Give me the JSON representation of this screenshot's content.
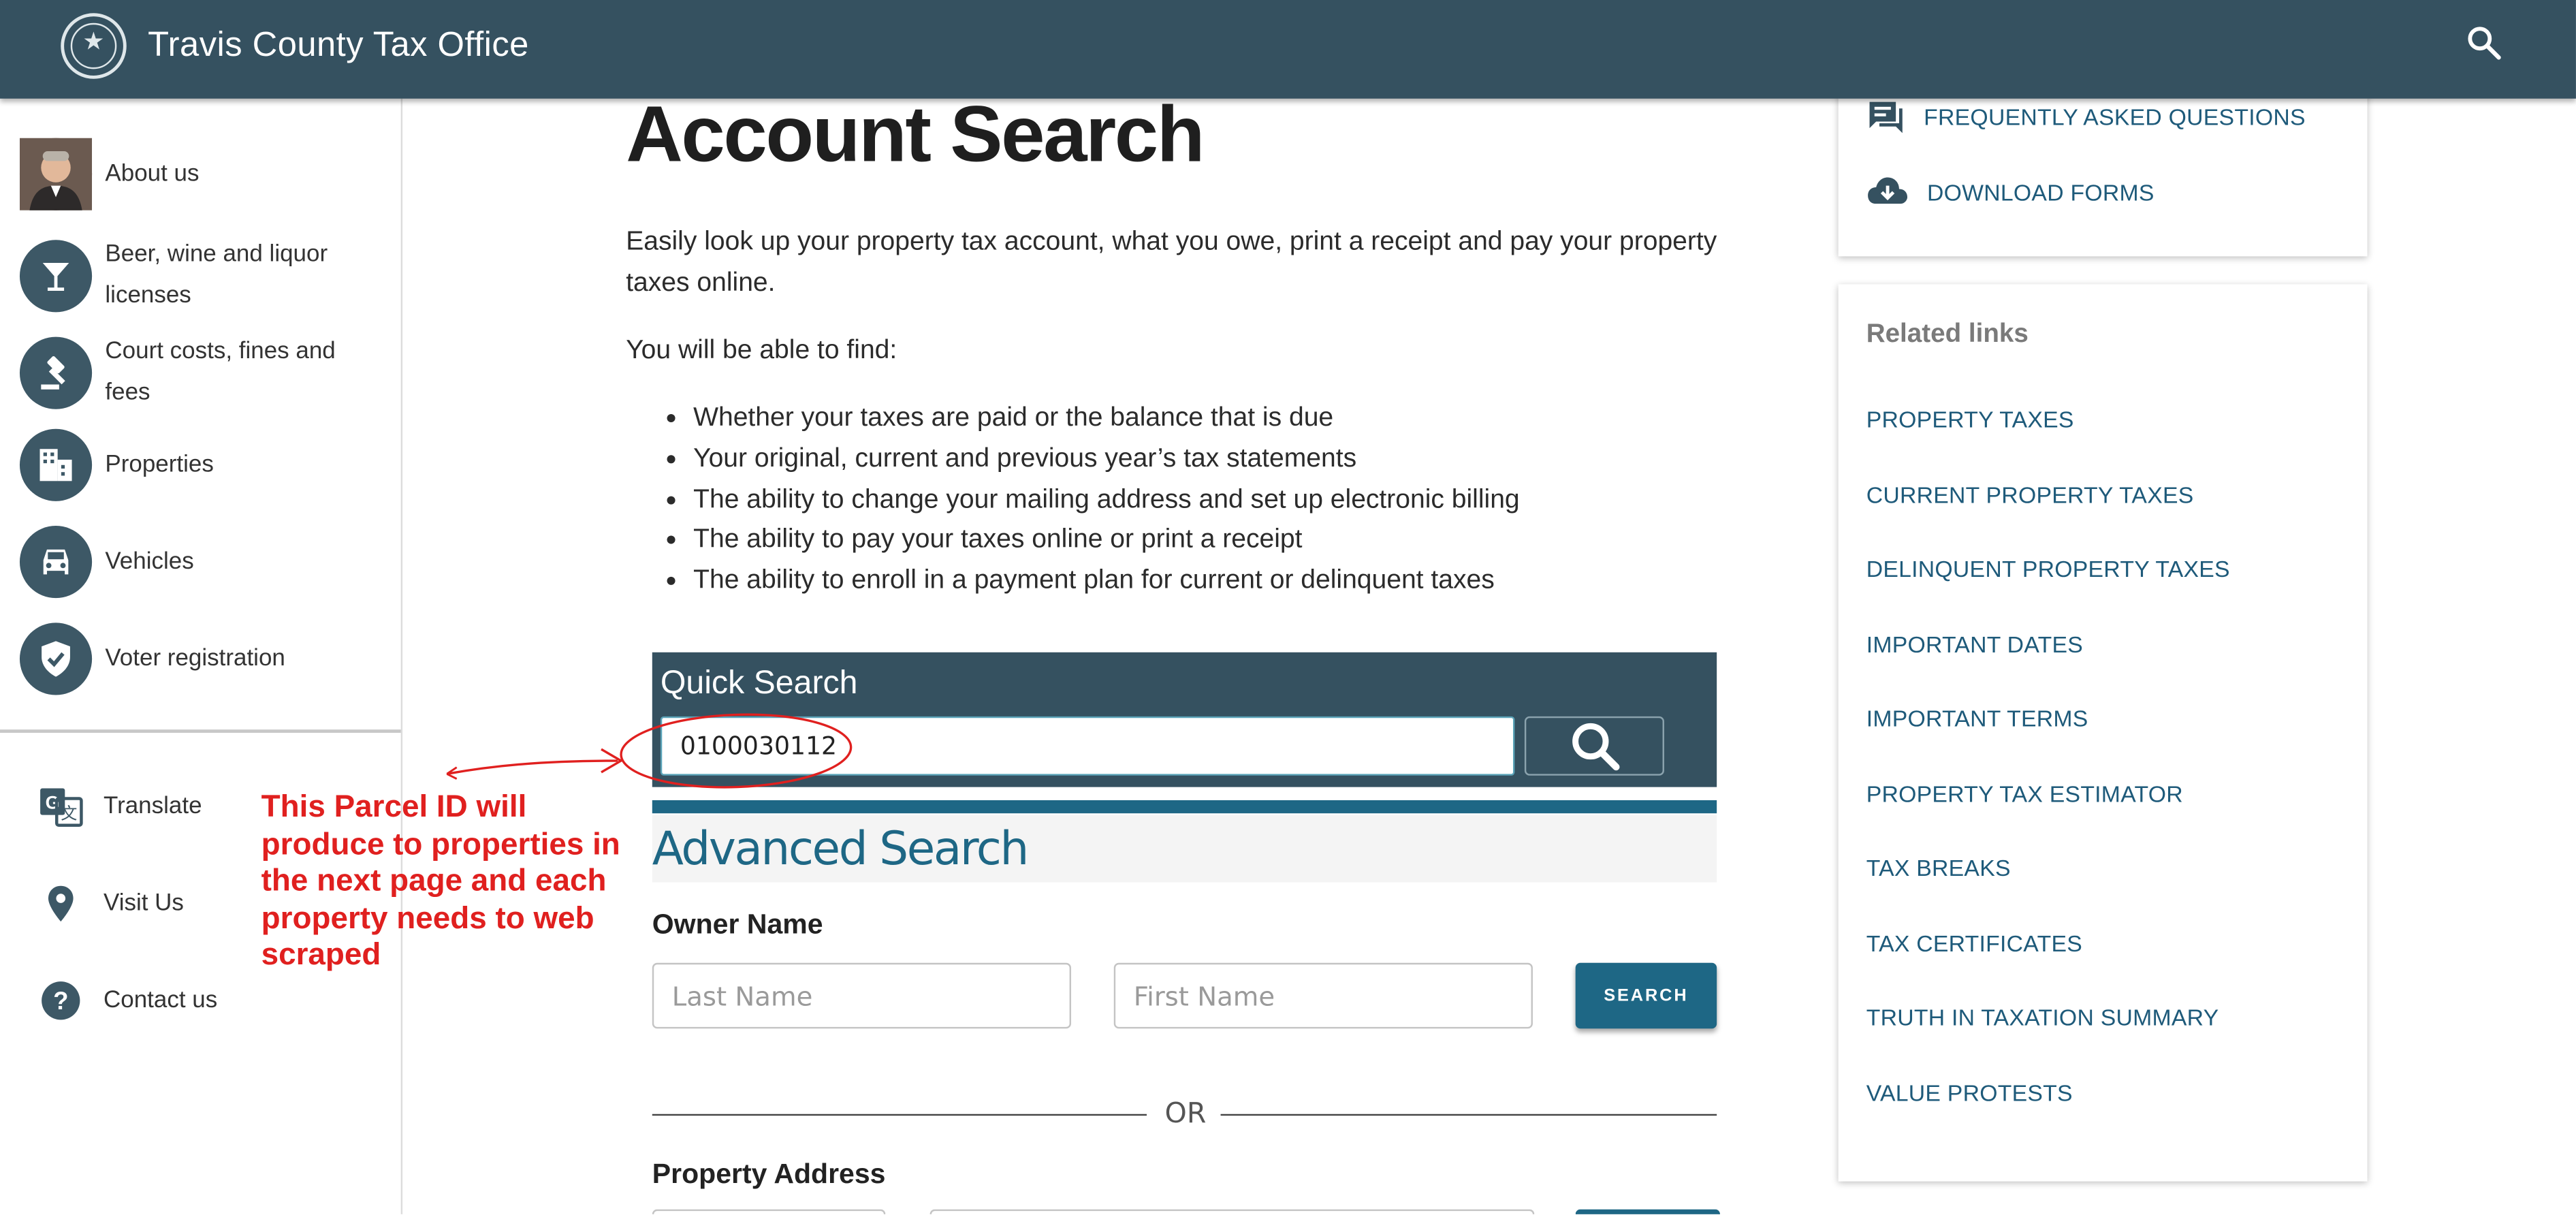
{
  "header": {
    "site_title": "Travis County Tax Office",
    "seal_icon": "county-seal-logo",
    "search_icon": "search-icon"
  },
  "sidebar": {
    "items": [
      {
        "label": "About us",
        "icon": "avatar-photo"
      },
      {
        "label": "Beer, wine and liquor licenses",
        "icon": "cocktail-glass-icon"
      },
      {
        "label": "Court costs, fines and fees",
        "icon": "gavel-icon"
      },
      {
        "label": "Properties",
        "icon": "building-icon"
      },
      {
        "label": "Vehicles",
        "icon": "car-icon"
      },
      {
        "label": "Voter registration",
        "icon": "shield-check-icon"
      }
    ],
    "utilities": [
      {
        "label": "Translate",
        "icon": "translate-icon"
      },
      {
        "label": "Visit Us",
        "icon": "location-pin-icon"
      },
      {
        "label": "Contact us",
        "icon": "help-circle-icon"
      }
    ]
  },
  "main": {
    "title": "Account Search",
    "intro": "Easily look up your property tax account, what you owe, print a receipt and pay your property taxes online.",
    "find_text": "You will be able to find:",
    "bullets": [
      "Whether your taxes are paid or the balance that is due",
      "Your original, current and previous year’s tax statements",
      "The ability to change your mailing address and set up electronic billing",
      "The ability to pay your taxes online or print a receipt",
      "The ability to enroll in a payment plan for current or delinquent taxes"
    ],
    "quick_search": {
      "title": "Quick Search",
      "value": "0100030112"
    },
    "advanced_search": {
      "title": "Advanced Search",
      "owner_label": "Owner Name",
      "last_name_placeholder": "Last Name",
      "first_name_placeholder": "First Name",
      "search_label": "SEARCH",
      "or_text": "OR",
      "address_label": "Property Address"
    }
  },
  "right": {
    "quick_links": [
      {
        "label": "FREQUENTLY ASKED QUESTIONS",
        "icon": "chat-bubble-icon"
      },
      {
        "label": "DOWNLOAD FORMS",
        "icon": "cloud-download-icon"
      }
    ],
    "related_title": "Related links",
    "related_links": [
      "PROPERTY TAXES",
      "CURRENT PROPERTY TAXES",
      "DELINQUENT PROPERTY TAXES",
      "IMPORTANT DATES",
      "IMPORTANT TERMS",
      "PROPERTY TAX ESTIMATOR",
      "TAX BREAKS",
      "TAX CERTIFICATES",
      "TRUTH IN TAXATION SUMMARY",
      "VALUE PROTESTS"
    ]
  },
  "annotation": {
    "text": "This Parcel ID will produce to properties in the next page and each property needs to web scraped",
    "color": "#e0201f"
  },
  "colors": {
    "header_bg": "#355160",
    "accent": "#1e6785",
    "link": "#1e5a7a"
  }
}
